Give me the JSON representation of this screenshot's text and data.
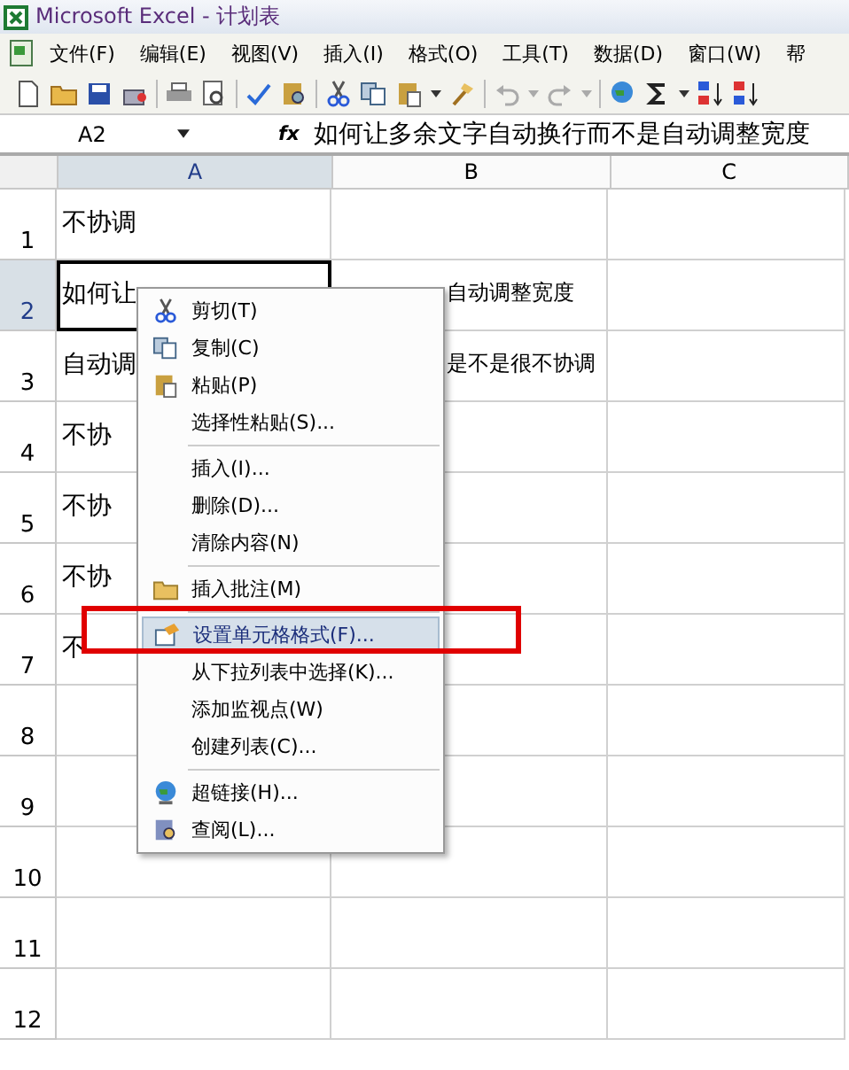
{
  "window": {
    "title": "Microsoft Excel - 计划表"
  },
  "menu_bar": [
    "文件(F)",
    "编辑(E)",
    "视图(V)",
    "插入(I)",
    "格式(O)",
    "工具(T)",
    "数据(D)",
    "窗口(W)",
    "帮"
  ],
  "formula_bar": {
    "name_box": "A2",
    "fx": "fx",
    "formula": "如何让多余文字自动换行而不是自动调整宽度"
  },
  "columns": [
    {
      "label": "A",
      "selected": true
    },
    {
      "label": "B",
      "selected": false
    },
    {
      "label": "C",
      "selected": false
    }
  ],
  "rows": [
    {
      "label": "1",
      "selected": false,
      "cells": [
        "不协调",
        "",
        ""
      ]
    },
    {
      "label": "2",
      "selected": true,
      "cells": [
        "如何让",
        "自动调整宽度",
        ""
      ]
    },
    {
      "label": "3",
      "selected": false,
      "cells": [
        "自动调",
        "是不是很不协调",
        ""
      ]
    },
    {
      "label": "4",
      "selected": false,
      "cells": [
        "不协",
        "",
        ""
      ]
    },
    {
      "label": "5",
      "selected": false,
      "cells": [
        "不协",
        "",
        ""
      ]
    },
    {
      "label": "6",
      "selected": false,
      "cells": [
        "不协",
        "",
        ""
      ]
    },
    {
      "label": "7",
      "selected": false,
      "cells": [
        "不",
        "",
        ""
      ]
    },
    {
      "label": "8",
      "selected": false,
      "cells": [
        "",
        "",
        ""
      ]
    },
    {
      "label": "9",
      "selected": false,
      "cells": [
        "",
        "",
        ""
      ]
    },
    {
      "label": "10",
      "selected": false,
      "cells": [
        "",
        "",
        ""
      ]
    },
    {
      "label": "11",
      "selected": false,
      "cells": [
        "",
        "",
        ""
      ]
    },
    {
      "label": "12",
      "selected": false,
      "cells": [
        "",
        "",
        ""
      ]
    }
  ],
  "context_menu": [
    {
      "kind": "item",
      "label": "剪切(T)",
      "selected": false,
      "annotated": false
    },
    {
      "kind": "item",
      "label": "复制(C)",
      "selected": false,
      "annotated": false
    },
    {
      "kind": "item",
      "label": "粘贴(P)",
      "selected": false,
      "annotated": false
    },
    {
      "kind": "item",
      "label": "选择性粘贴(S)...",
      "selected": false,
      "annotated": false
    },
    {
      "kind": "separator"
    },
    {
      "kind": "item",
      "label": "插入(I)...",
      "selected": false,
      "annotated": false
    },
    {
      "kind": "item",
      "label": "删除(D)...",
      "selected": false,
      "annotated": false
    },
    {
      "kind": "item",
      "label": "清除内容(N)",
      "selected": false,
      "annotated": false
    },
    {
      "kind": "separator"
    },
    {
      "kind": "item",
      "label": "插入批注(M)",
      "selected": false,
      "annotated": false
    },
    {
      "kind": "separator"
    },
    {
      "kind": "item",
      "label": "设置单元格格式(F)...",
      "selected": true,
      "annotated": true
    },
    {
      "kind": "item",
      "label": "从下拉列表中选择(K)...",
      "selected": false,
      "annotated": false
    },
    {
      "kind": "item",
      "label": "添加监视点(W)",
      "selected": false,
      "annotated": false
    },
    {
      "kind": "item",
      "label": "创建列表(C)...",
      "selected": false,
      "annotated": false
    },
    {
      "kind": "separator"
    },
    {
      "kind": "item",
      "label": "超链接(H)...",
      "selected": false,
      "annotated": false
    },
    {
      "kind": "item",
      "label": "查阅(L)...",
      "selected": false,
      "annotated": false
    }
  ]
}
